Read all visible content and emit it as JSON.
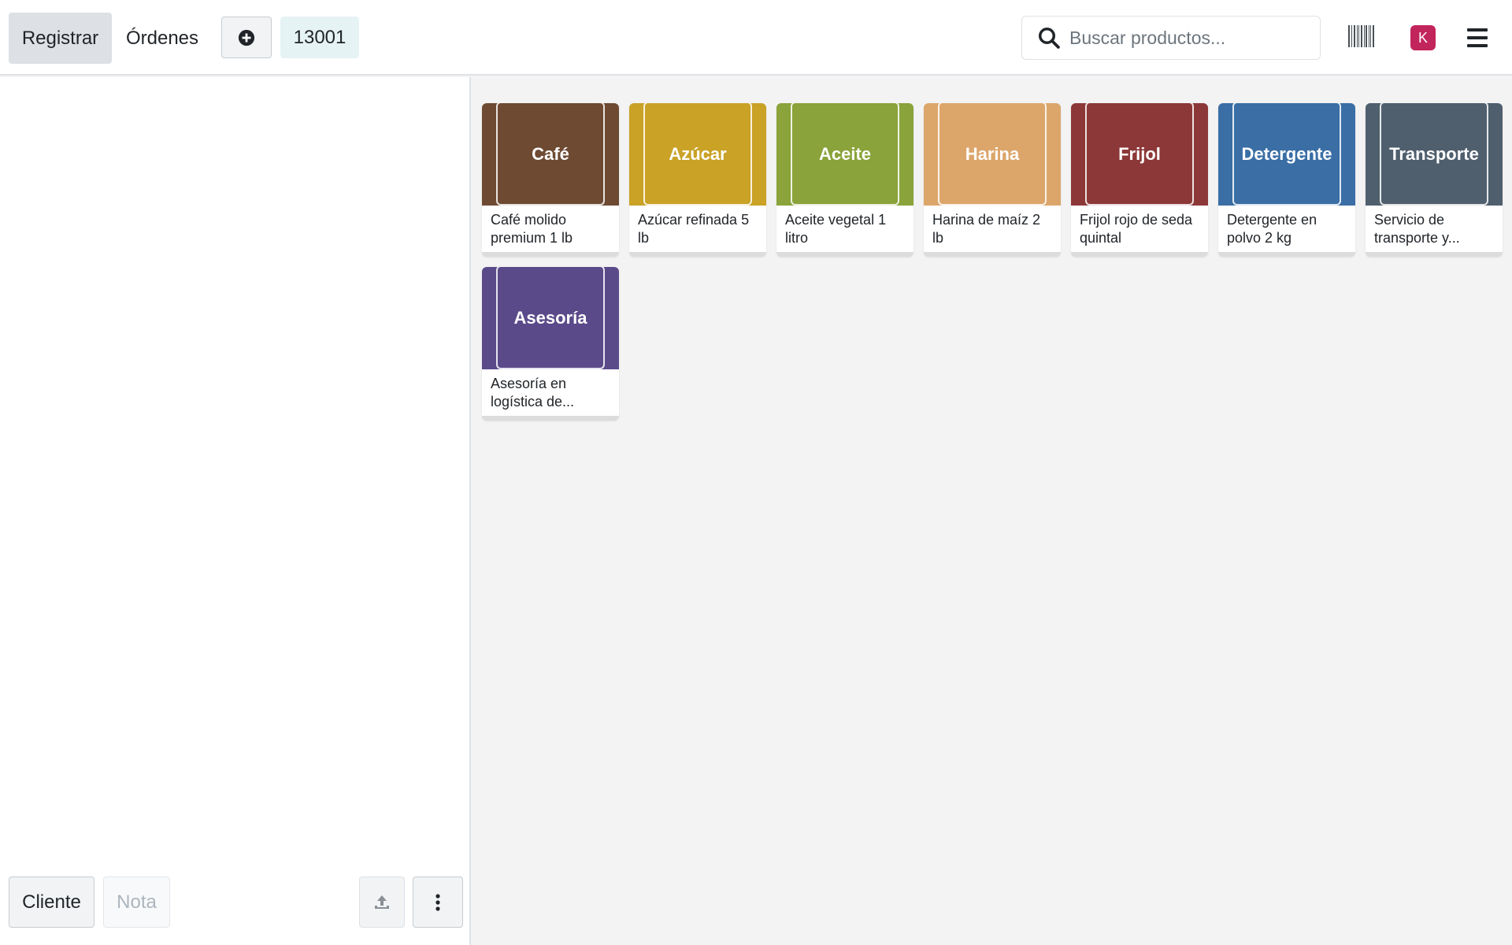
{
  "header": {
    "register_label": "Registrar",
    "orders_label": "Órdenes",
    "order_number": "13001",
    "search_placeholder": "Buscar productos...",
    "avatar_initial": "K"
  },
  "actions": {
    "client_label": "Cliente",
    "note_label": "Nota"
  },
  "products": [
    {
      "image_text": "Café",
      "name": "Café molido premium 1 lb",
      "color": "#6e4a33"
    },
    {
      "image_text": "Azúcar",
      "name": "Azúcar refinada 5 lb",
      "color": "#c9a226"
    },
    {
      "image_text": "Aceite",
      "name": "Aceite vegetal 1 litro",
      "color": "#8aa33a"
    },
    {
      "image_text": "Harina",
      "name": "Harina de maíz 2 lb",
      "color": "#dca66b"
    },
    {
      "image_text": "Frijol",
      "name": "Frijol rojo de seda quintal",
      "color": "#8c3838"
    },
    {
      "image_text": "Detergente",
      "name": "Detergente en polvo 2 kg",
      "color": "#3a6ea5"
    },
    {
      "image_text": "Transporte",
      "name": "Servicio de transporte y...",
      "color": "#4f5f6e"
    },
    {
      "image_text": "Asesoría",
      "name": "Asesoría en logística de...",
      "color": "#5b4a8a"
    }
  ]
}
